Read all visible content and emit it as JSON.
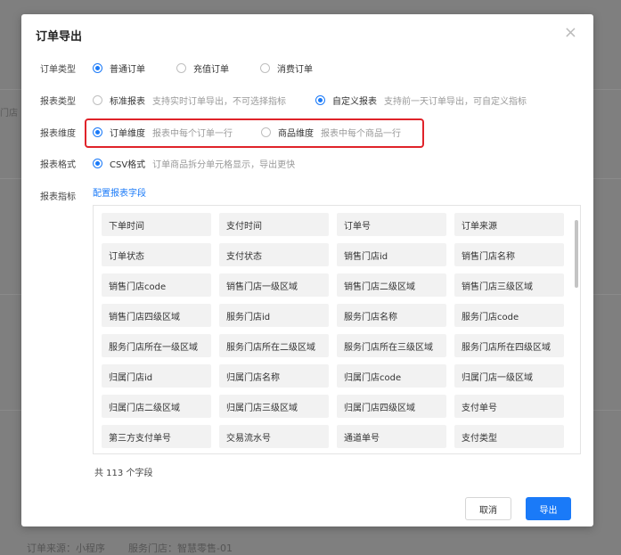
{
  "background": {
    "left_text": "门店",
    "bottom_items": [
      "订单来源：小程序",
      "服务门店：智慧零售-01"
    ]
  },
  "dialog": {
    "title": "订单导出",
    "close_symbol": "×",
    "order_type": {
      "label": "订单类型",
      "options": [
        {
          "label": "普通订单",
          "checked": true
        },
        {
          "label": "充值订单",
          "checked": false
        },
        {
          "label": "消费订单",
          "checked": false
        }
      ]
    },
    "report_type": {
      "label": "报表类型",
      "options": [
        {
          "label": "标准报表",
          "hint": "支持实时订单导出，不可选择指标",
          "checked": false
        },
        {
          "label": "自定义报表",
          "hint": "支持前一天订单导出，可自定义指标",
          "checked": true
        }
      ]
    },
    "report_dimension": {
      "label": "报表维度",
      "options": [
        {
          "label": "订单维度",
          "hint": "报表中每个订单一行",
          "checked": true
        },
        {
          "label": "商品维度",
          "hint": "报表中每个商品一行",
          "checked": false
        }
      ]
    },
    "report_format": {
      "label": "报表格式",
      "options": [
        {
          "label": "CSV格式",
          "hint": "订单商品拆分单元格显示，导出更快",
          "checked": true
        }
      ]
    },
    "report_metrics": {
      "label": "报表指标",
      "config_link": "配置报表字段",
      "fields": [
        "下单时间",
        "支付时间",
        "订单号",
        "订单来源",
        "订单状态",
        "支付状态",
        "销售门店id",
        "销售门店名称",
        "销售门店code",
        "销售门店一级区域",
        "销售门店二级区域",
        "销售门店三级区域",
        "销售门店四级区域",
        "服务门店id",
        "服务门店名称",
        "服务门店code",
        "服务门店所在一级区域",
        "服务门店所在二级区域",
        "服务门店所在三级区域",
        "服务门店所在四级区域",
        "归属门店id",
        "归属门店名称",
        "归属门店code",
        "归属门店一级区域",
        "归属门店二级区域",
        "归属门店三级区域",
        "归属门店四级区域",
        "支付单号",
        "第三方支付单号",
        "交易流水号",
        "通道单号",
        "支付类型"
      ],
      "total_text": "共 113 个字段"
    },
    "buttons": {
      "cancel": "取消",
      "export": "导出"
    },
    "colors": {
      "accent": "#1a7af8",
      "highlight": "#e0232a"
    }
  }
}
